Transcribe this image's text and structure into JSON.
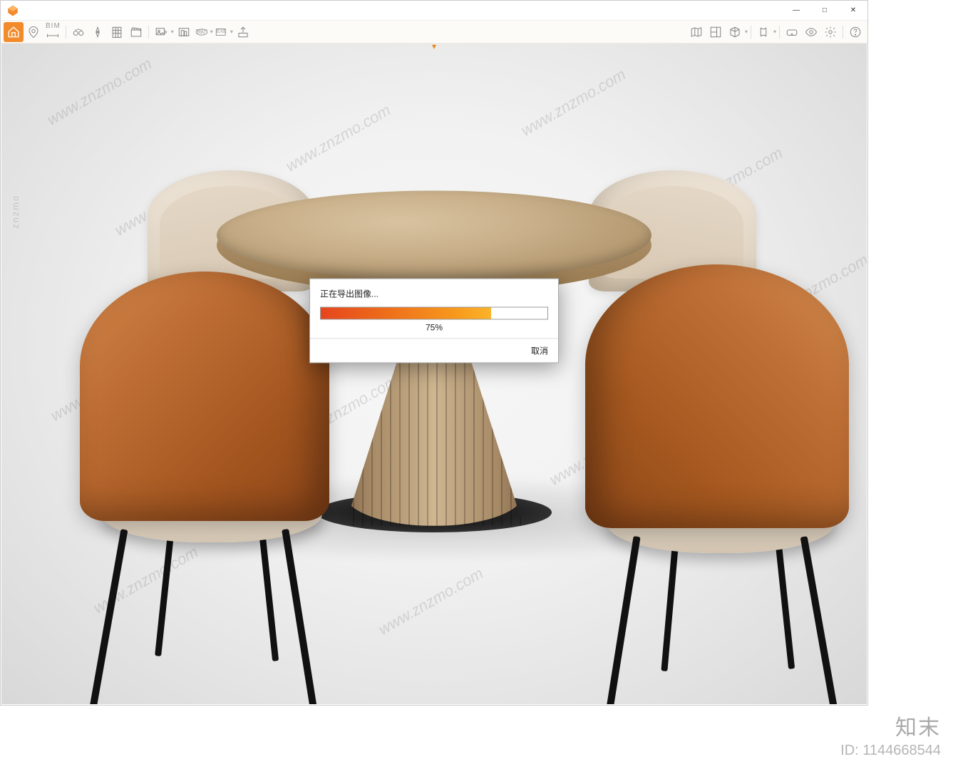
{
  "window": {
    "minimize": "—",
    "maximize": "□",
    "close": "✕"
  },
  "toolbar": {
    "left": {
      "bim": "BIM",
      "panorama": "360°",
      "exe": "EXE"
    },
    "collapse": "▾"
  },
  "dialog": {
    "title": "正在导出图像...",
    "progress_value": 75,
    "progress_text": "75%",
    "cancel": "取消"
  },
  "watermark": {
    "url": "www.znzmo.com",
    "side": "znzmo",
    "brand": "知末",
    "id_label": "ID: 1144668544"
  }
}
